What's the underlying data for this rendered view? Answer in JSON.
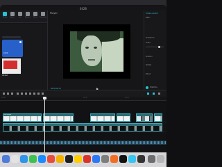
{
  "window": {
    "title": "0426"
  },
  "toolbar": {
    "items": [
      {
        "label": "Media",
        "active": true
      },
      {
        "label": "Audio",
        "active": false
      },
      {
        "label": "Text",
        "active": false
      },
      {
        "label": "Stickers",
        "active": false
      },
      {
        "label": "Effects",
        "active": false
      },
      {
        "label": "Transitions",
        "active": false
      }
    ]
  },
  "media": {
    "import_label": "Import",
    "thumbnail_label": "0426",
    "thumbnail2_caption": "Added"
  },
  "player": {
    "title": "Player",
    "timecode": "00:00:09:27"
  },
  "inspector": {
    "tabs": "Video  Audio",
    "rows": [
      {
        "label": "Basic"
      },
      {
        "label": "Transform"
      },
      {
        "label": "Scale"
      },
      {
        "label": "Position"
      },
      {
        "label": "Rotate"
      },
      {
        "label": "Blend"
      },
      {
        "label": "Stabilize"
      }
    ]
  },
  "timeline": {
    "ticks": [
      "00:00",
      "00:10",
      "00:20",
      "00:30"
    ],
    "clip_label": "0426.mp4"
  },
  "colors": {
    "accent": "#27c3d4",
    "clip": "#2b6e78",
    "audio": "#1f3a4a"
  }
}
